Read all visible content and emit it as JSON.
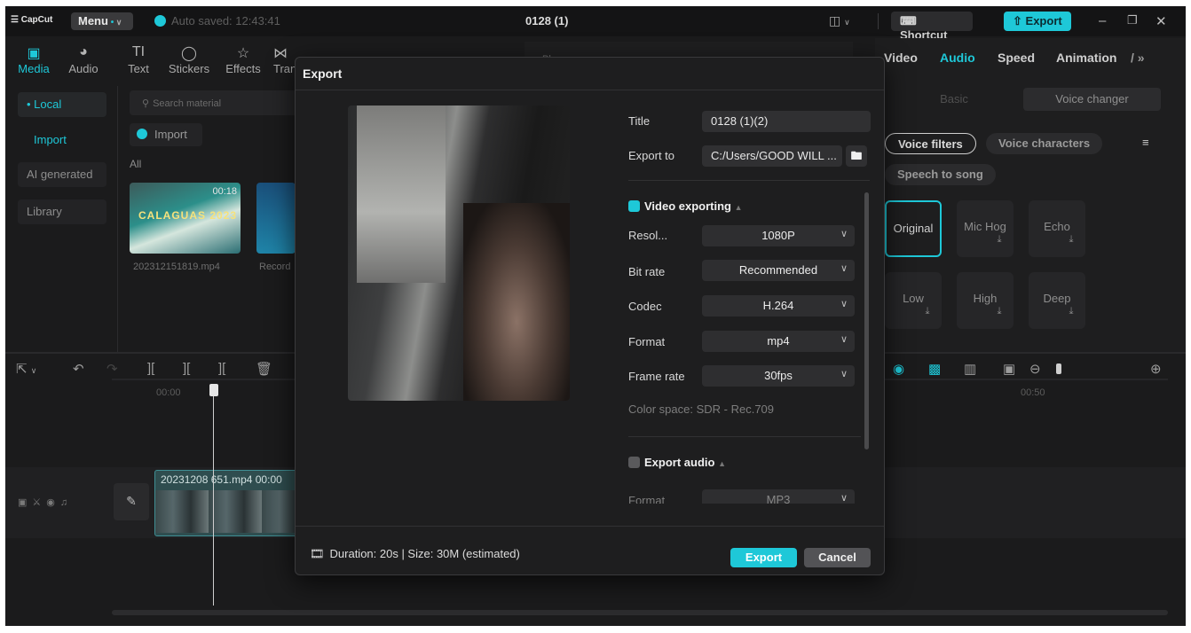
{
  "titlebar": {
    "logo": "CapCut",
    "menu": "Menu",
    "autosave": "Auto saved: 12:43:41",
    "project_title": "0128 (1)",
    "shortcut": "Shortcut",
    "export": "Export"
  },
  "toolbar": [
    {
      "label": "Media",
      "icon": "media-icon"
    },
    {
      "label": "Audio",
      "icon": "audio-icon"
    },
    {
      "label": "Text",
      "icon": "text-icon"
    },
    {
      "label": "Stickers",
      "icon": "stickers-icon"
    },
    {
      "label": "Effects",
      "icon": "effects-icon"
    },
    {
      "label": "Tran",
      "icon": "transitions-icon"
    }
  ],
  "left_nav": {
    "local": "• Local",
    "import": "Import",
    "ai_generated": "AI generated",
    "library": "Library"
  },
  "media": {
    "search_placeholder": "Search material",
    "import": "Import",
    "all": "All",
    "clip1_duration": "00:18",
    "clip1_overlay": "CALAGUAS 2023",
    "clip1_name": "202312151819.mp4",
    "clip2_name": "Record"
  },
  "player_label": "Player",
  "right_panel": {
    "tabs": [
      "Video",
      "Audio",
      "Speed",
      "Animation"
    ],
    "subtabs": [
      "Basic",
      "Voice changer"
    ],
    "voice_filters": "Voice filters",
    "voice_characters": "Voice characters",
    "speech_to_song": "Speech to song",
    "voices": [
      "Original",
      "Mic Hog",
      "Echo",
      "Low",
      "High",
      "Deep"
    ]
  },
  "timeline": {
    "time_start": "00:00",
    "time_mark": "00:50",
    "clip_label": "20231208 651.mp4  00:00"
  },
  "dialog": {
    "title": "Export",
    "title_label": "Title",
    "title_value": "0128 (1)(2)",
    "export_to_label": "Export to",
    "export_to_value": "C:/Users/GOOD WILL ...",
    "video_exporting": "Video exporting",
    "resolution_label": "Resol...",
    "resolution_value": "1080P",
    "bitrate_label": "Bit rate",
    "bitrate_value": "Recommended",
    "codec_label": "Codec",
    "codec_value": "H.264",
    "format_label": "Format",
    "format_value": "mp4",
    "framerate_label": "Frame rate",
    "framerate_value": "30fps",
    "color_space": "Color space: SDR - Rec.709",
    "export_audio": "Export audio",
    "audio_format_label": "Format",
    "audio_format_value": "MP3",
    "duration_size": "Duration: 20s | Size: 30M (estimated)",
    "export_btn": "Export",
    "cancel_btn": "Cancel"
  },
  "colors": {
    "accent": "#1ec8d8",
    "background": "#1b1b1c",
    "dialog": "#1e1e1f"
  }
}
